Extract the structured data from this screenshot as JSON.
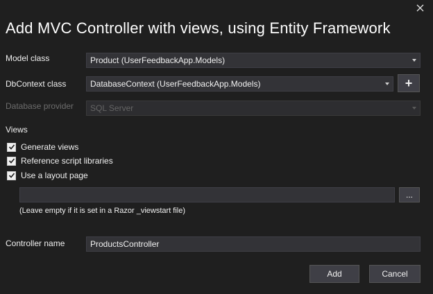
{
  "dialog": {
    "title": "Add MVC Controller with views, using Entity Framework",
    "close_icon": "close-icon"
  },
  "model_class": {
    "label": "Model class",
    "value": "Product (UserFeedbackApp.Models)"
  },
  "dbcontext_class": {
    "label": "DbContext class",
    "value": "DatabaseContext (UserFeedbackApp.Models)",
    "add_label": "+"
  },
  "database_provider": {
    "label": "Database provider",
    "value": "SQL Server"
  },
  "views": {
    "heading": "Views",
    "options": [
      {
        "label": "Generate views",
        "checked": true
      },
      {
        "label": "Reference script libraries",
        "checked": true
      },
      {
        "label": "Use a layout page",
        "checked": true
      }
    ],
    "layout_path": "",
    "browse_label": "...",
    "hint": "(Leave empty if it is set in a Razor _viewstart file)"
  },
  "controller_name": {
    "label": "Controller name",
    "value": "ProductsController"
  },
  "actions": {
    "add_label": "Add",
    "cancel_label": "Cancel"
  },
  "colors": {
    "background": "#1f1f1f",
    "field": "#333337",
    "button": "#3f3f46"
  }
}
